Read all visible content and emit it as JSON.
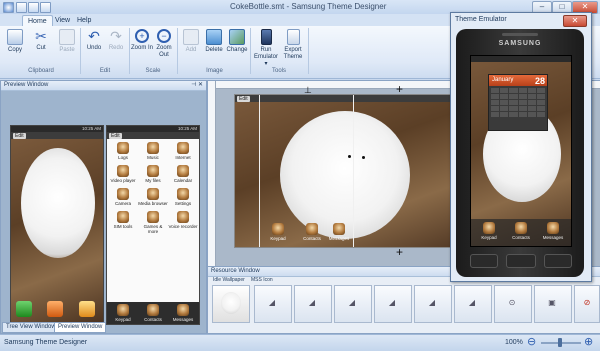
{
  "app": {
    "title": "CokeBottle.smt - Samsung Theme Designer",
    "window_controls": {
      "minimize": "–",
      "maximize": "□",
      "close": "✕"
    }
  },
  "menu": {
    "tabs": [
      "Home",
      "View",
      "Help"
    ],
    "active": "Home"
  },
  "ribbon": {
    "groups": [
      {
        "label": "Clipboard",
        "buttons": [
          {
            "label": "Copy",
            "icon": "copy-icon",
            "enabled": true
          },
          {
            "label": "Cut",
            "icon": "cut-icon",
            "enabled": true
          },
          {
            "label": "Paste",
            "icon": "paste-icon",
            "enabled": false
          }
        ]
      },
      {
        "label": "Edit",
        "buttons": [
          {
            "label": "Undo",
            "icon": "undo-icon",
            "enabled": true
          },
          {
            "label": "Redo",
            "icon": "redo-icon",
            "enabled": false
          }
        ]
      },
      {
        "label": "Scale",
        "buttons": [
          {
            "label": "Zoom In",
            "icon": "zoom-in-icon",
            "enabled": true
          },
          {
            "label": "Zoom Out",
            "icon": "zoom-out-icon",
            "enabled": true
          }
        ]
      },
      {
        "label": "Image",
        "buttons": [
          {
            "label": "Add",
            "icon": "add-image-icon",
            "enabled": false
          },
          {
            "label": "Delete",
            "icon": "delete-image-icon",
            "enabled": true
          },
          {
            "label": "Change",
            "icon": "change-image-icon",
            "enabled": true
          }
        ]
      },
      {
        "label": "Tools",
        "buttons": [
          {
            "label": "Run Emulator",
            "icon": "run-emulator-icon",
            "enabled": true
          },
          {
            "label": "Export Theme",
            "icon": "export-theme-icon",
            "enabled": true
          }
        ]
      }
    ]
  },
  "preview": {
    "title": "Preview Window",
    "screens": [
      {
        "time": "10:25 AM",
        "softkey": "Edit"
      },
      {
        "time": "10:25 AM",
        "softkey": "Edit"
      }
    ],
    "menu_items": [
      "Logs",
      "Music",
      "Internet",
      "Video player",
      "My files",
      "Calendar",
      "Camera",
      "Media browser",
      "Settings",
      "SIM tools",
      "Games & more",
      "Voice recorder",
      "Keypad",
      "Contacts",
      "Messages"
    ]
  },
  "bottom_tabs": [
    "Tree View Window",
    "Preview Window"
  ],
  "bottom_active": "Preview Window",
  "canvas": {
    "softkey": "Edit",
    "dock_labels": [
      "Keypad",
      "Contacts",
      "Messages"
    ]
  },
  "resource": {
    "title": "Resource Window",
    "item_labels": [
      "Idle Wallpaper",
      "MSS Icon"
    ]
  },
  "emulator": {
    "title": "Theme Emulator",
    "brand": "SAMSUNG",
    "calendar_month": "January",
    "calendar_day": "28",
    "dock_labels": [
      "Keypad",
      "Contacts",
      "Messages"
    ]
  },
  "status": {
    "app_name": "Samsung Theme Designer",
    "zoom": "100%"
  },
  "colors": {
    "ribbon_bg": "#dfe9f7",
    "accent_blue": "#1e395b",
    "calendar_orange": "#e46a3a"
  }
}
